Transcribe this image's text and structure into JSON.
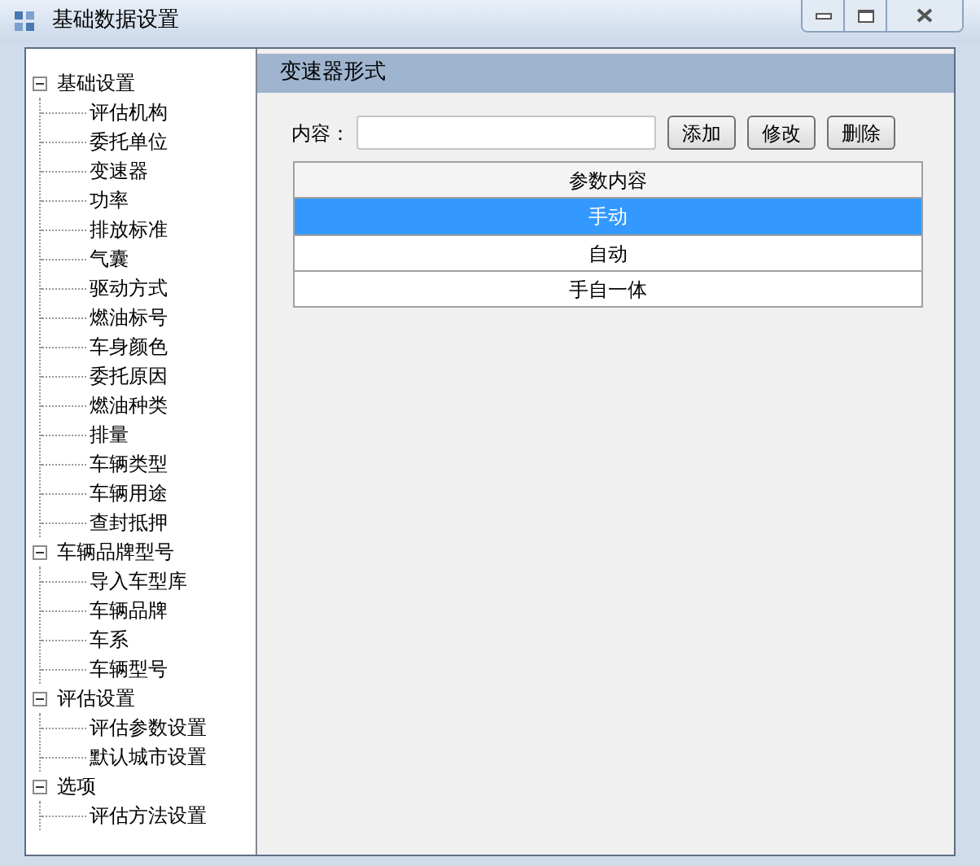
{
  "window": {
    "title": "基础数据设置"
  },
  "tree": [
    {
      "label": "基础设置",
      "expanded": true,
      "children": [
        {
          "label": "评估机构"
        },
        {
          "label": "委托单位"
        },
        {
          "label": "变速器"
        },
        {
          "label": "功率"
        },
        {
          "label": "排放标准"
        },
        {
          "label": "气囊"
        },
        {
          "label": "驱动方式"
        },
        {
          "label": "燃油标号"
        },
        {
          "label": "车身颜色"
        },
        {
          "label": "委托原因"
        },
        {
          "label": "燃油种类"
        },
        {
          "label": "排量"
        },
        {
          "label": "车辆类型"
        },
        {
          "label": "车辆用途"
        },
        {
          "label": "查封抵押"
        }
      ]
    },
    {
      "label": "车辆品牌型号",
      "expanded": true,
      "children": [
        {
          "label": "导入车型库"
        },
        {
          "label": "车辆品牌"
        },
        {
          "label": "车系"
        },
        {
          "label": "车辆型号"
        }
      ]
    },
    {
      "label": "评估设置",
      "expanded": true,
      "children": [
        {
          "label": "评估参数设置"
        },
        {
          "label": "默认城市设置"
        }
      ]
    },
    {
      "label": "选项",
      "expanded": true,
      "children": [
        {
          "label": "评估方法设置"
        }
      ]
    }
  ],
  "panel": {
    "title": "变速器形式",
    "field_label": "内容：",
    "buttons": [
      "添加",
      "修改",
      "删除"
    ],
    "table": {
      "columns": [
        "参数内容"
      ],
      "rows": [
        {
          "cells": [
            "手动"
          ],
          "selected": true
        },
        {
          "cells": [
            "自动"
          ],
          "selected": false
        },
        {
          "cells": [
            "手自一体"
          ],
          "selected": false
        }
      ]
    }
  }
}
